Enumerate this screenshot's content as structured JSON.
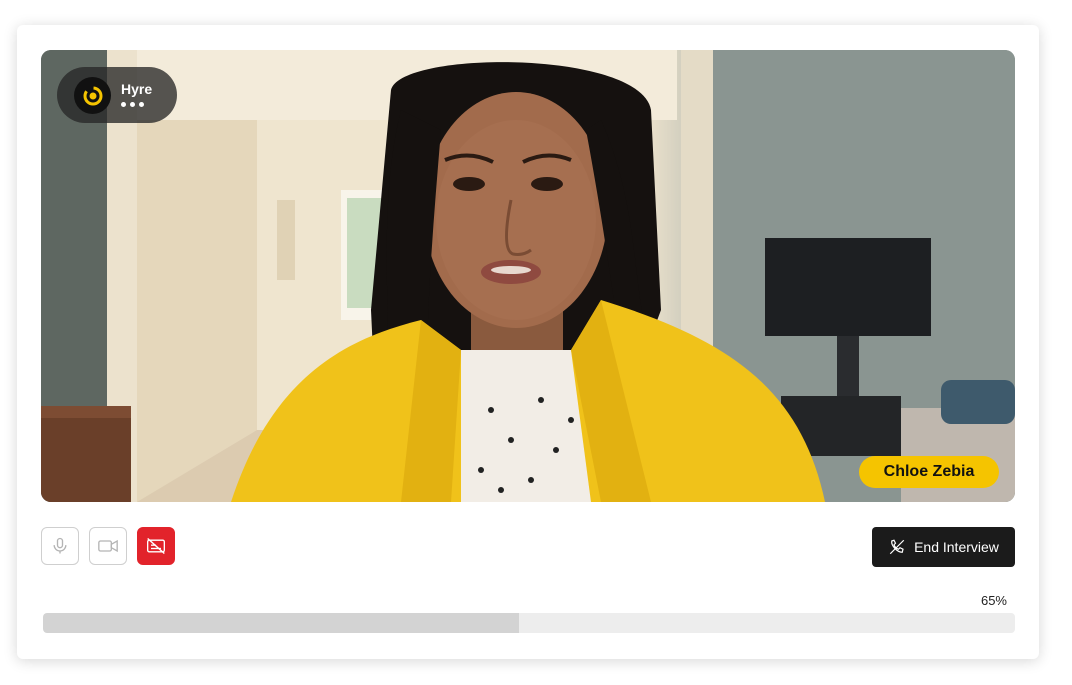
{
  "brand": {
    "name": "Hyre",
    "logo_icon": "hyre-logo-icon",
    "accent": "#f5c400"
  },
  "participant": {
    "name": "Chloe Zebia"
  },
  "controls": {
    "mic_icon": "microphone-icon",
    "camera_icon": "video-camera-icon",
    "captions_icon": "captions-off-icon",
    "end_label": "End Interview",
    "end_icon": "phone-off-icon"
  },
  "progress": {
    "value": 0.49,
    "label": "65%"
  },
  "colors": {
    "danger": "#e2232b",
    "dark_button": "#1b1b1b",
    "name_tag": "#f5c400"
  }
}
